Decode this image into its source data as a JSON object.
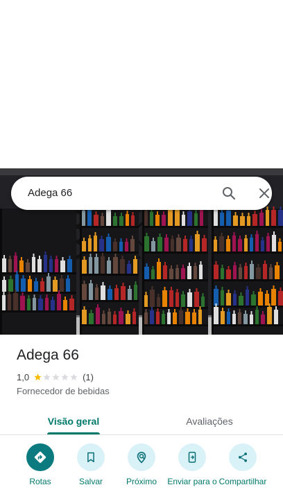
{
  "search": {
    "query": "Adega 66"
  },
  "photo": {
    "alt": "Adega 66"
  },
  "place": {
    "name": "Adega 66",
    "rating": "1,0",
    "stars_filled": 1,
    "stars_total": 5,
    "review_count": "(1)",
    "category": "Fornecedor de bebidas"
  },
  "tabs": [
    {
      "label": "Visão geral",
      "active": true
    },
    {
      "label": "Avaliações",
      "active": false
    }
  ],
  "actions": [
    {
      "label": "Rotas",
      "icon": "directions-icon"
    },
    {
      "label": "Salvar",
      "icon": "bookmark-icon"
    },
    {
      "label": "Próximo",
      "icon": "nearby-icon"
    },
    {
      "label": "Enviar para o",
      "icon": "send-to-phone-icon"
    },
    {
      "label": "Compartilhar",
      "icon": "share-icon"
    }
  ],
  "colors": {
    "accent": "#00796b",
    "primary_button": "#0b7b80",
    "button_tint": "#d9f2f7",
    "star": "#fbbc04"
  }
}
